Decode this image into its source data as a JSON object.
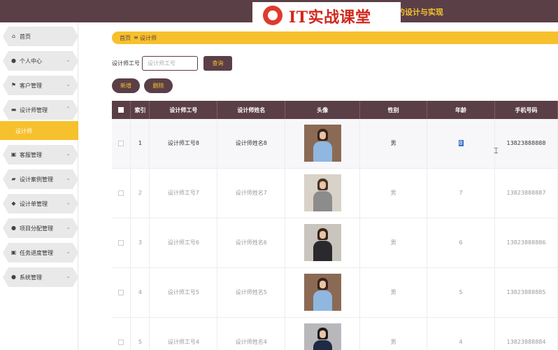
{
  "header": {
    "logo_text": "IT实战课堂",
    "title_fragment": "的设计与实现"
  },
  "sidebar": {
    "items": [
      {
        "label": "首页",
        "icon": "home-icon",
        "chevron": false
      },
      {
        "label": "个人中心",
        "icon": "user-icon",
        "chevron": true
      },
      {
        "label": "客户管理",
        "icon": "flag-icon",
        "chevron": true
      },
      {
        "label": "设计师管理",
        "icon": "message-icon",
        "chevron": true,
        "expanded": true
      },
      {
        "label": "客服管理",
        "icon": "briefcase-icon",
        "chevron": true
      },
      {
        "label": "设计案例管理",
        "icon": "truck-icon",
        "chevron": true
      },
      {
        "label": "设计单管理",
        "icon": "pin-icon",
        "chevron": true
      },
      {
        "label": "项目分配管理",
        "icon": "user-icon",
        "chevron": true
      },
      {
        "label": "任务进度管理",
        "icon": "briefcase-icon",
        "chevron": true
      },
      {
        "label": "系统管理",
        "icon": "user-icon",
        "chevron": true
      }
    ],
    "subitem": "设计师"
  },
  "breadcrumb": {
    "home": "首页",
    "sep": "≡",
    "current": "设计师"
  },
  "search": {
    "label": "设计师工号",
    "placeholder": "设计师工号",
    "query_button": "查询"
  },
  "actions": {
    "add_button": "新增",
    "delete_button": "删除"
  },
  "table": {
    "headers": [
      "索引",
      "设计师工号",
      "设计师姓名",
      "头像",
      "性别",
      "年龄",
      "手机号码"
    ],
    "rows": [
      {
        "index": "1",
        "id": "设计师工号8",
        "name": "设计师姓名8",
        "gender": "男",
        "age": "8",
        "phone": "13823888888"
      },
      {
        "index": "2",
        "id": "设计师工号7",
        "name": "设计师姓名7",
        "gender": "男",
        "age": "7",
        "phone": "13823888887"
      },
      {
        "index": "3",
        "id": "设计师工号6",
        "name": "设计师姓名6",
        "gender": "男",
        "age": "6",
        "phone": "13823888886"
      },
      {
        "index": "4",
        "id": "设计师工号5",
        "name": "设计师姓名5",
        "gender": "男",
        "age": "5",
        "phone": "13823888885"
      },
      {
        "index": "5",
        "id": "设计师工号4",
        "name": "设计师姓名4",
        "gender": "男",
        "age": "4",
        "phone": "13823888884"
      }
    ]
  },
  "colors": {
    "primary": "#5b3f47",
    "accent": "#f6c12c"
  }
}
